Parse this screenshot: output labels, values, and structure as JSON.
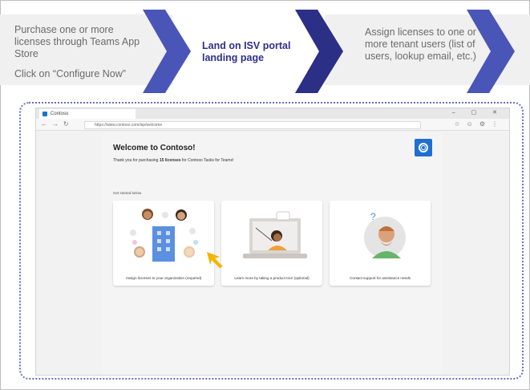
{
  "flow": {
    "step1": {
      "line1": "Purchase one or more licenses through Teams App Store",
      "cta": "Click on “Configure Now”"
    },
    "step2": {
      "label": "Land on ISV portal landing page"
    },
    "step3": {
      "label": "Assign licenses to one or more tenant users (list of users, lookup email, etc.)"
    },
    "colors": {
      "chevron_light": "#4a55b8",
      "chevron_dark": "#2c2f86",
      "chevron_end": "#4a55b8"
    }
  },
  "browser": {
    "tab_title": "Contoso",
    "url": "https://www.contoso.com/isp/welcome",
    "window_controls": "– ▢ ✕"
  },
  "page": {
    "title": "Welcome to Contoso!",
    "thanks_prefix": "Thank you for purchasing ",
    "thanks_bold": "15 licenses",
    "thanks_suffix": " for Contoso Tasks for Teams!",
    "section_label": "Get started below",
    "cards": [
      {
        "label": "Assign licenses to your organization (required)",
        "icon": "people-building-icon"
      },
      {
        "label": "Learn more by taking a product tour (optional)",
        "icon": "presenter-laptop-icon"
      },
      {
        "label": "Contact support for assistance needs",
        "icon": "support-person-icon"
      }
    ]
  },
  "accent": {
    "brand_blue": "#1f6fd1",
    "cursor_yellow": "#f5b400",
    "dotted_border": "#6a6fc8"
  }
}
